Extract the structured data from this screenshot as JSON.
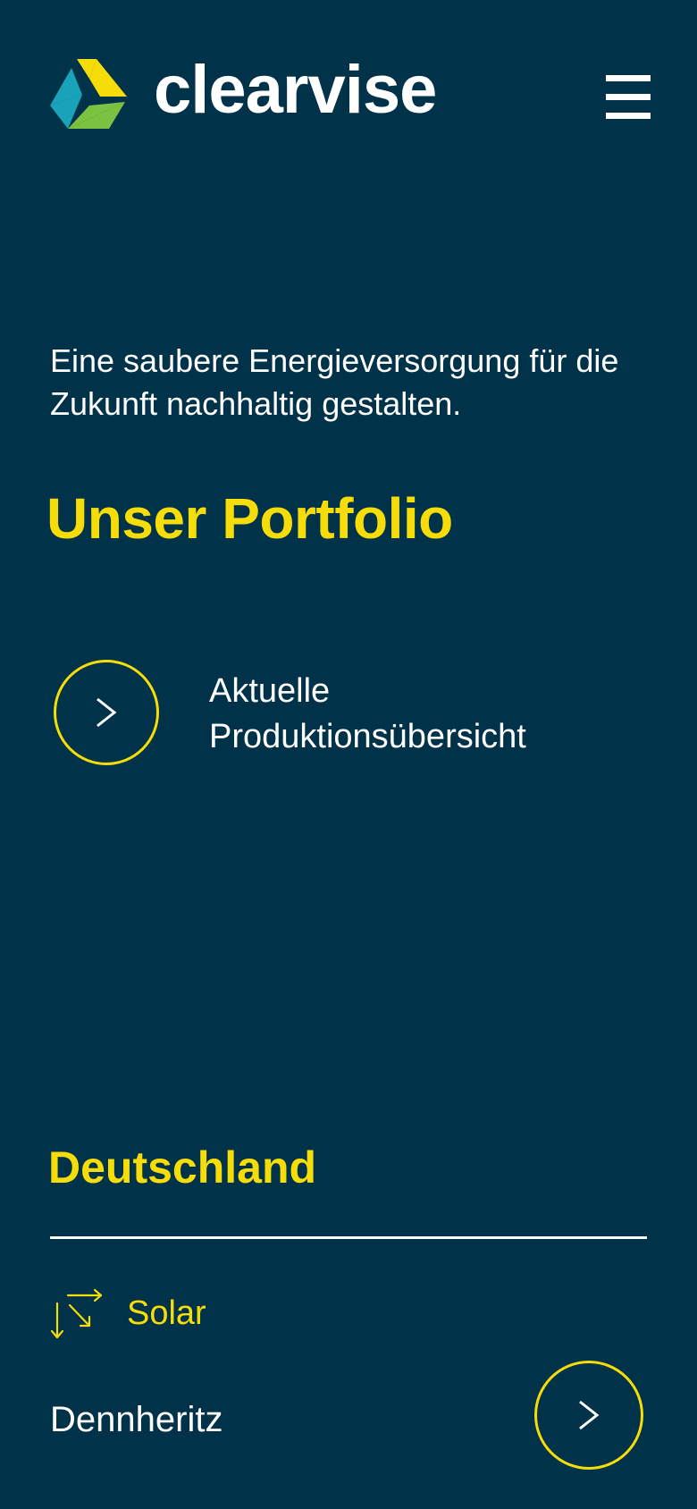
{
  "brand": {
    "name": "clearvise",
    "colors": {
      "background": "#003249",
      "accent": "#f6dd0a",
      "text": "#ffffff",
      "logo_yellow": "#f6dd0a",
      "logo_teal": "#18a3b9",
      "logo_green": "#7cc242"
    }
  },
  "header": {
    "menu_icon": "hamburger-menu-icon"
  },
  "hero": {
    "tagline": "Eine saubere Energieversorgung für die Zukunft nachhaltig gestalten.",
    "portfolio_title": "Unser Portfolio"
  },
  "production": {
    "link_label": "Aktuelle Produktionsübersicht",
    "button_icon": "chevron-right-icon"
  },
  "portfolio": {
    "country": "Deutschland",
    "category_icon": "solar-arrows-icon",
    "category": "Solar",
    "projects": [
      {
        "name": "Dennheritz",
        "button_icon": "chevron-right-icon"
      }
    ]
  }
}
